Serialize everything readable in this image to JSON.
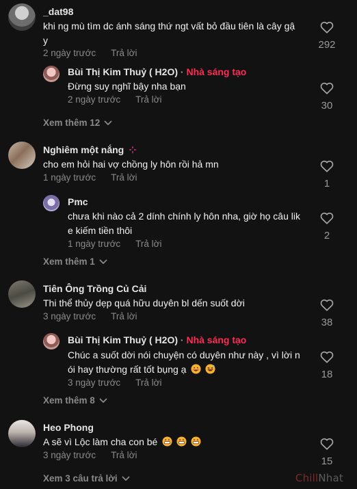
{
  "comments": [
    {
      "username": "_dat98",
      "text": "khi ng mù tìm dc ánh sáng thứ ngt vất bỏ đầu tiên là cây gậ",
      "text2": "y",
      "time": "2 ngày trước",
      "reply_label": "Trả lời",
      "likes": "292",
      "replies": [
        {
          "username": "Bùi Thị Kim Thuỷ ( H2O)",
          "sep": "·",
          "badge": "Nhà sáng tạo",
          "text": "Đừng suy nghĩ bậy nha bạn",
          "time": "2 ngày trước",
          "reply_label": "Trả lời",
          "likes": "30"
        }
      ],
      "more_label": "Xem thêm 12"
    },
    {
      "username": "Nghiêm một nắng",
      "text": "cho em hỏi hai vợ chồng ly hôn rồi hả mn",
      "time": "1 ngày trước",
      "reply_label": "Trả lời",
      "likes": "1",
      "replies": [
        {
          "username": "Pmc",
          "text": "chưa khi nào cả 2 dính chính ly hôn nha, giờ họ câu lik",
          "text2": "e kiếm tiền thôi",
          "time": "1 ngày trước",
          "reply_label": "Trả lời",
          "likes": "2"
        }
      ],
      "more_label": "Xem thêm 1"
    },
    {
      "username": "Tiên Ông Trồng Củ Cải",
      "text": "Thi thể thủy dẹp quá hữu duyên bl dến suốt dời",
      "time": "3 ngày trước",
      "reply_label": "Trả lời",
      "likes": "38",
      "replies": [
        {
          "username": "Bùi Thị Kim Thuỷ ( H2O)",
          "sep": "·",
          "badge": "Nhà sáng tạo",
          "text": "Chúc a suốt dời nói chuyện có duyên như này , vì lời n",
          "text2": "ói hay thường rất tốt bụng ạ",
          "time": "3 ngày trước",
          "reply_label": "Trả lời",
          "likes": "18"
        }
      ],
      "more_label": "Xem thêm 8"
    },
    {
      "username": "Heo Phong",
      "text": "A sẽ vì Lộc làm cha con bé",
      "time": "3 ngày trước",
      "reply_label": "Trả lời",
      "likes": "15",
      "more_label": "Xem 3 câu trả lời"
    }
  ],
  "icons": {
    "like": "heart-outline-icon",
    "expand": "chevron-down-icon",
    "badge_emoji": "pink-sparkle-icon",
    "reaction_emoji": "grinning-face-icon",
    "laugh_emoji": "laughing-face-icon"
  },
  "colors": {
    "background": "#121212",
    "creator_badge": "#fe2c55",
    "muted_text": "#8a8a8a"
  },
  "watermark": {
    "part1": "Chill",
    "part2": "Nhat"
  }
}
